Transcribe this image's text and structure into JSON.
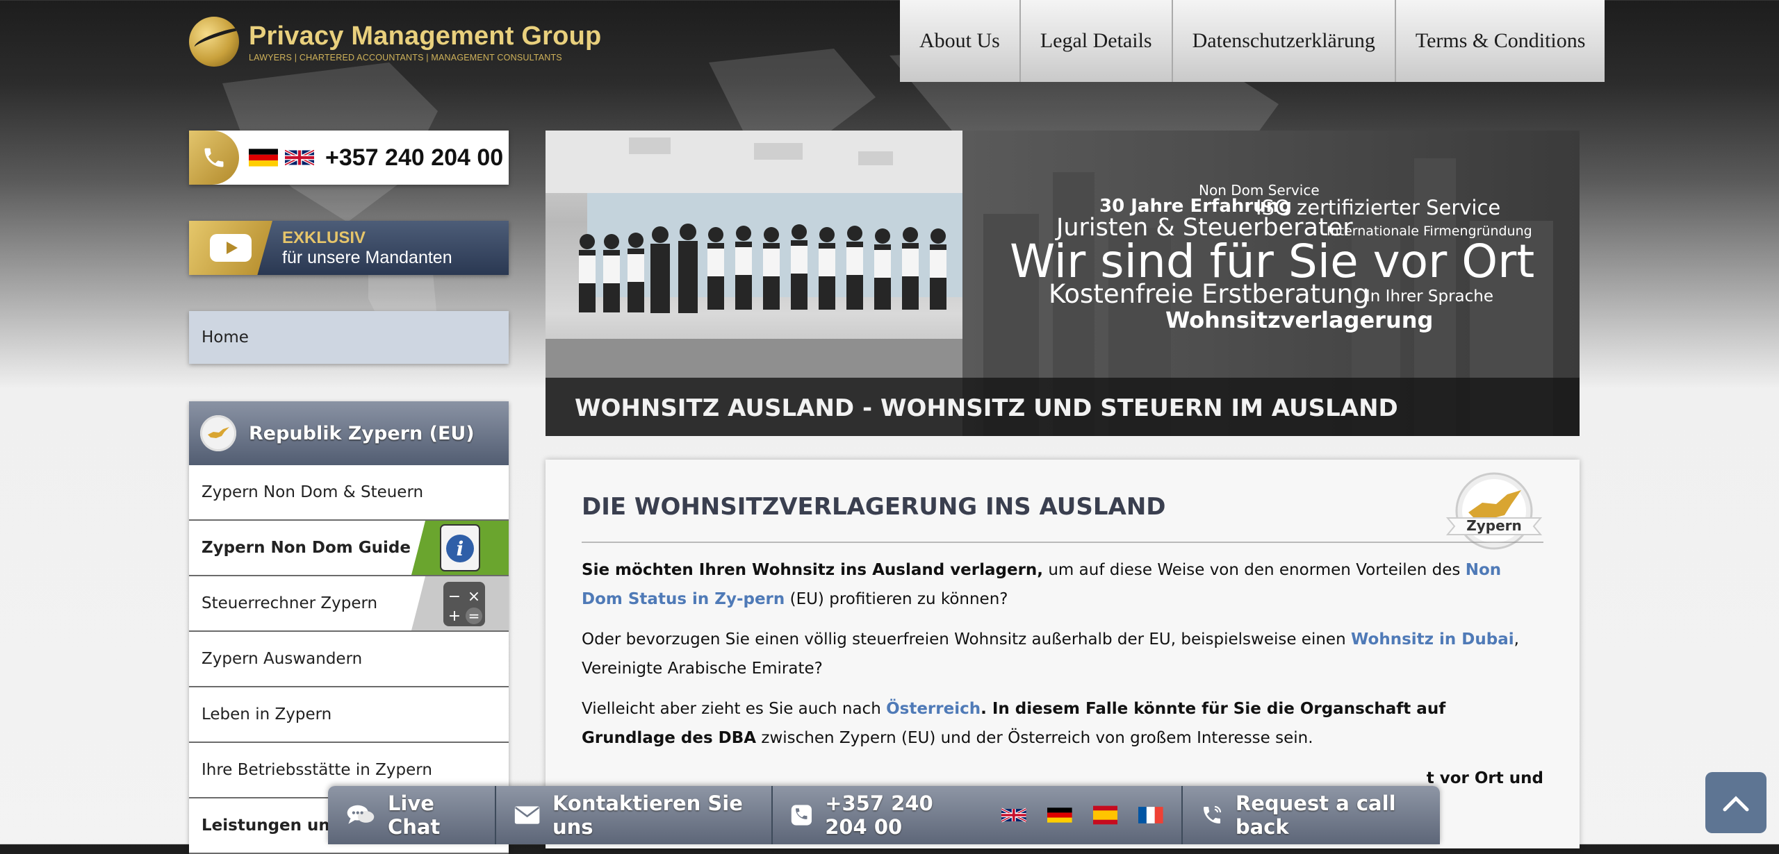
{
  "brand": {
    "title": "Privacy Management Group",
    "subtitle": "LAWYERS | CHARTERED ACCOUNTANTS | MANAGEMENT CONSULTANTS",
    "gold": "#c9a13c"
  },
  "topnav": {
    "items": [
      "About Us",
      "Legal Details",
      "Datenschutzerklärung",
      "Terms & Conditions"
    ]
  },
  "phonebox": {
    "number": "+357 240 204 00",
    "flags": [
      "de-flag",
      "uk-flag"
    ]
  },
  "exklusiv": {
    "line1": "EXKLUSIV",
    "line2": "für unsere Mandanten"
  },
  "home": {
    "label": "Home"
  },
  "sidenav": {
    "title": "Republik Zypern (EU)",
    "items": [
      "Zypern Non Dom & Steuern",
      "Zypern Non Dom Guide",
      "Steuerrechner Zypern",
      "Zypern Auswandern",
      "Leben in Zypern",
      "Ihre Betriebsstätte in Zypern",
      "Leistungen und G"
    ]
  },
  "banner": {
    "t1": "Non Dom Service",
    "t2": "30 Jahre Erfahrung",
    "t3": "ISO zertifizierter Service",
    "t4": "Juristen & Steuerberater",
    "t5": "Internationale Firmengründung",
    "t6": "Wir sind für Sie vor Ort",
    "t7": "Kostenfreie Erstberatung",
    "t8": "In Ihrer Sprache",
    "t9": "Wohnsitzverlagerung",
    "caption": "WOHNSITZ AUSLAND - WOHNSITZ UND STEUERN IM AUSLAND"
  },
  "content": {
    "heading": "DIE WOHNSITZVERLAGERUNG INS AUSLAND",
    "badge": "Zypern",
    "p1_bold": "Sie möchten Ihren Wohnsitz ins Ausland verlagern,",
    "p1_a": " um auf diese Weise von den enormen Vorteilen des ",
    "p1_link": "Non Dom Status in Zy-pern",
    "p1_b": " (EU) profitieren zu können?",
    "p2_a": "Oder bevorzugen Sie einen völlig steuerfreien Wohnsitz außerhalb der EU, beispielsweise einen ",
    "p2_link": "Wohnsitz in Dubai",
    "p2_b": ", Vereinigte Arabische Emirate?",
    "p3_a": "Vielleicht aber zieht es Sie auch nach ",
    "p3_link": "Österreich",
    "p3_b": ". In diesem Falle könnte für Sie die ",
    "p3_bold": "Organschaft auf Grundlage des DBA",
    "p3_c": " zwischen Zypern (EU) und der Österreich von großem Interesse sein.",
    "p4_tail": "t vor Ort und"
  },
  "bottombar": {
    "live_chat": "Live Chat",
    "contact": "Kontaktieren Sie uns",
    "phone": "+357 240 204 00",
    "flags": [
      "uk-flag",
      "de-flag",
      "es-flag",
      "fr-flag"
    ],
    "callback": "Request a call back"
  },
  "colors": {
    "link": "#4f7ab7",
    "nav_bg": "#d9d9d9",
    "sidenav_head": "#5f6a7e",
    "bottombar": "#6f7889"
  }
}
